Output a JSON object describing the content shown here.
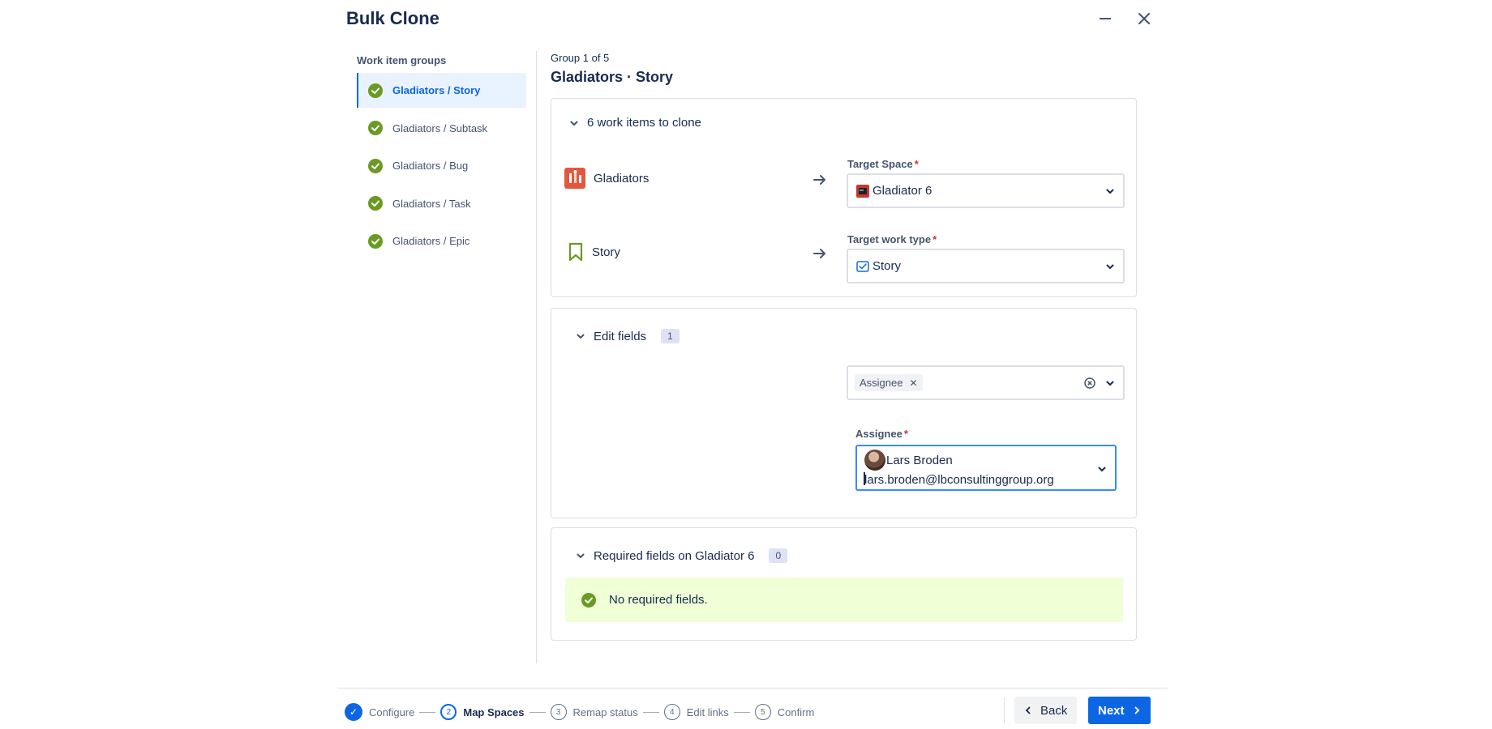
{
  "header": {
    "title": "Bulk Clone"
  },
  "sidebar": {
    "label": "Work item groups",
    "items": [
      {
        "label": "Gladiators / Story",
        "active": true
      },
      {
        "label": "Gladiators / Subtask"
      },
      {
        "label": "Gladiators / Bug"
      },
      {
        "label": "Gladiators / Task"
      },
      {
        "label": "Gladiators / Epic"
      }
    ]
  },
  "main": {
    "group_counter": "Group 1 of 5",
    "group_title": "Gladiators · Story",
    "clone_section": {
      "heading": "6 work items to clone",
      "space_row": {
        "source": "Gladiators",
        "target_label": "Target Space",
        "target_value": "Gladiator 6"
      },
      "type_row": {
        "source": "Story",
        "target_label": "Target work type",
        "target_value": "Story"
      }
    },
    "edit_fields": {
      "heading": "Edit fields",
      "count": "1",
      "chip": "Assignee",
      "assignee_label": "Assignee",
      "assignee_name": "Lars Broden",
      "assignee_email": "lars.broden@lbconsultinggroup.org"
    },
    "required_fields": {
      "heading": "Required fields on Gladiator 6",
      "count": "0",
      "message": "No required fields."
    }
  },
  "footer": {
    "steps": [
      {
        "num": "✓",
        "label": "Configure",
        "state": "done"
      },
      {
        "num": "2",
        "label": "Map Spaces",
        "state": "current"
      },
      {
        "num": "3",
        "label": "Remap status",
        "state": "todo"
      },
      {
        "num": "4",
        "label": "Edit links",
        "state": "todo"
      },
      {
        "num": "5",
        "label": "Confirm",
        "state": "todo"
      }
    ],
    "back_label": "Back",
    "next_label": "Next"
  },
  "colors": {
    "accent": "#0c66e4",
    "success": "#6a9a23",
    "success_bg": "#efffd6",
    "required": "#c9372c"
  },
  "icons": [
    "minimize-icon",
    "close-icon",
    "check-circle-icon",
    "chevron-down-icon",
    "arrow-right-icon",
    "space-avatar-icon",
    "bookmark-icon",
    "story-type-icon",
    "clear-icon",
    "chevron-left-icon",
    "chevron-right-icon"
  ]
}
